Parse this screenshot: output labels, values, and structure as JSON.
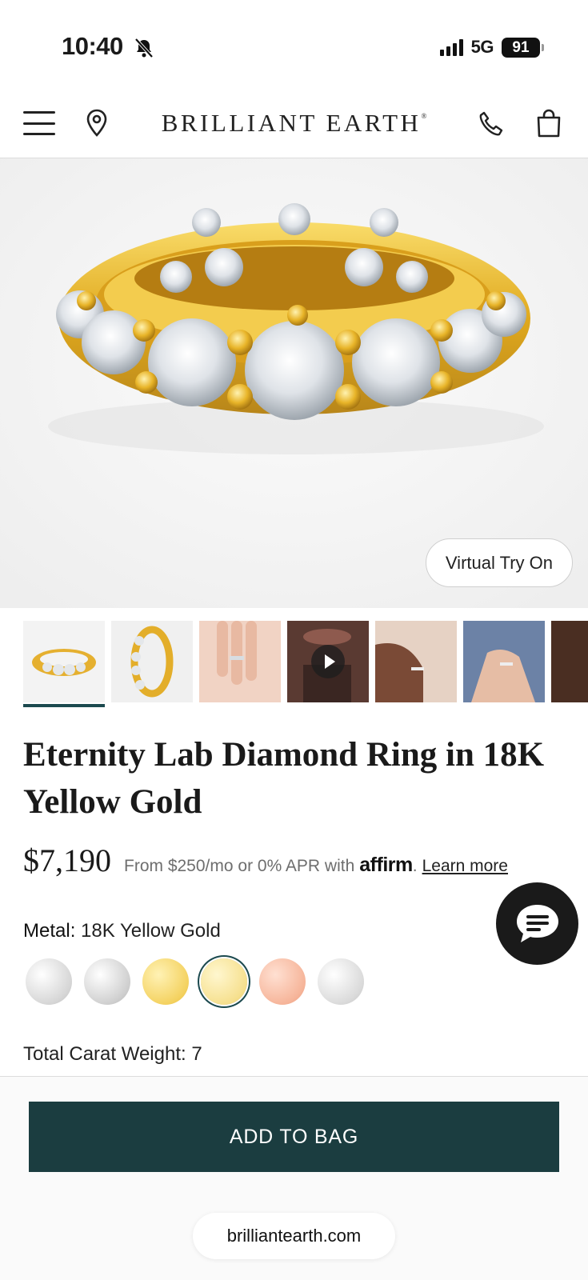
{
  "status_bar": {
    "time": "10:40",
    "network": "5G",
    "battery": "91",
    "icons": [
      "bell-slash-icon",
      "signal-icon",
      "battery-icon"
    ]
  },
  "header": {
    "brand": "BRILLIANT EARTH",
    "brand_mark": "®",
    "icons": [
      "menu-icon",
      "location-pin-icon",
      "phone-icon",
      "shopping-bag-icon"
    ]
  },
  "hero": {
    "try_on_label": "Virtual Try On"
  },
  "thumbnails": {
    "count": 7,
    "selected_index": 0,
    "video_index": 3
  },
  "product": {
    "title": "Eternity Lab Diamond Ring in 18K Yellow Gold",
    "price": "$7,190",
    "financing_text": "From $250/mo or 0% APR with",
    "affirm_logo": "affirm",
    "affirm_suffix": ".",
    "learn_more": "Learn more",
    "metal_label": "Metal:",
    "metal_value": "18K Yellow Gold",
    "carat_label": "Total Carat Weight:",
    "carat_value": "7"
  },
  "metal_swatches": [
    {
      "name": "white-gold",
      "color": "#e6e6e6"
    },
    {
      "name": "platinum",
      "color": "#dedede"
    },
    {
      "name": "yellow-gold-14k",
      "color": "#f7db7c"
    },
    {
      "name": "yellow-gold-18k",
      "color": "#f8e39a",
      "selected": true
    },
    {
      "name": "rose-gold",
      "color": "#f6b39a"
    },
    {
      "name": "white-gold-alt",
      "color": "#e9e9e9"
    }
  ],
  "actions": {
    "add_to_bag": "ADD TO BAG"
  },
  "browser": {
    "url": "brilliantearth.com"
  },
  "colors": {
    "accent": "#1b3d40",
    "gold": "#e9b922",
    "chat_bg": "#1a1a1a"
  }
}
